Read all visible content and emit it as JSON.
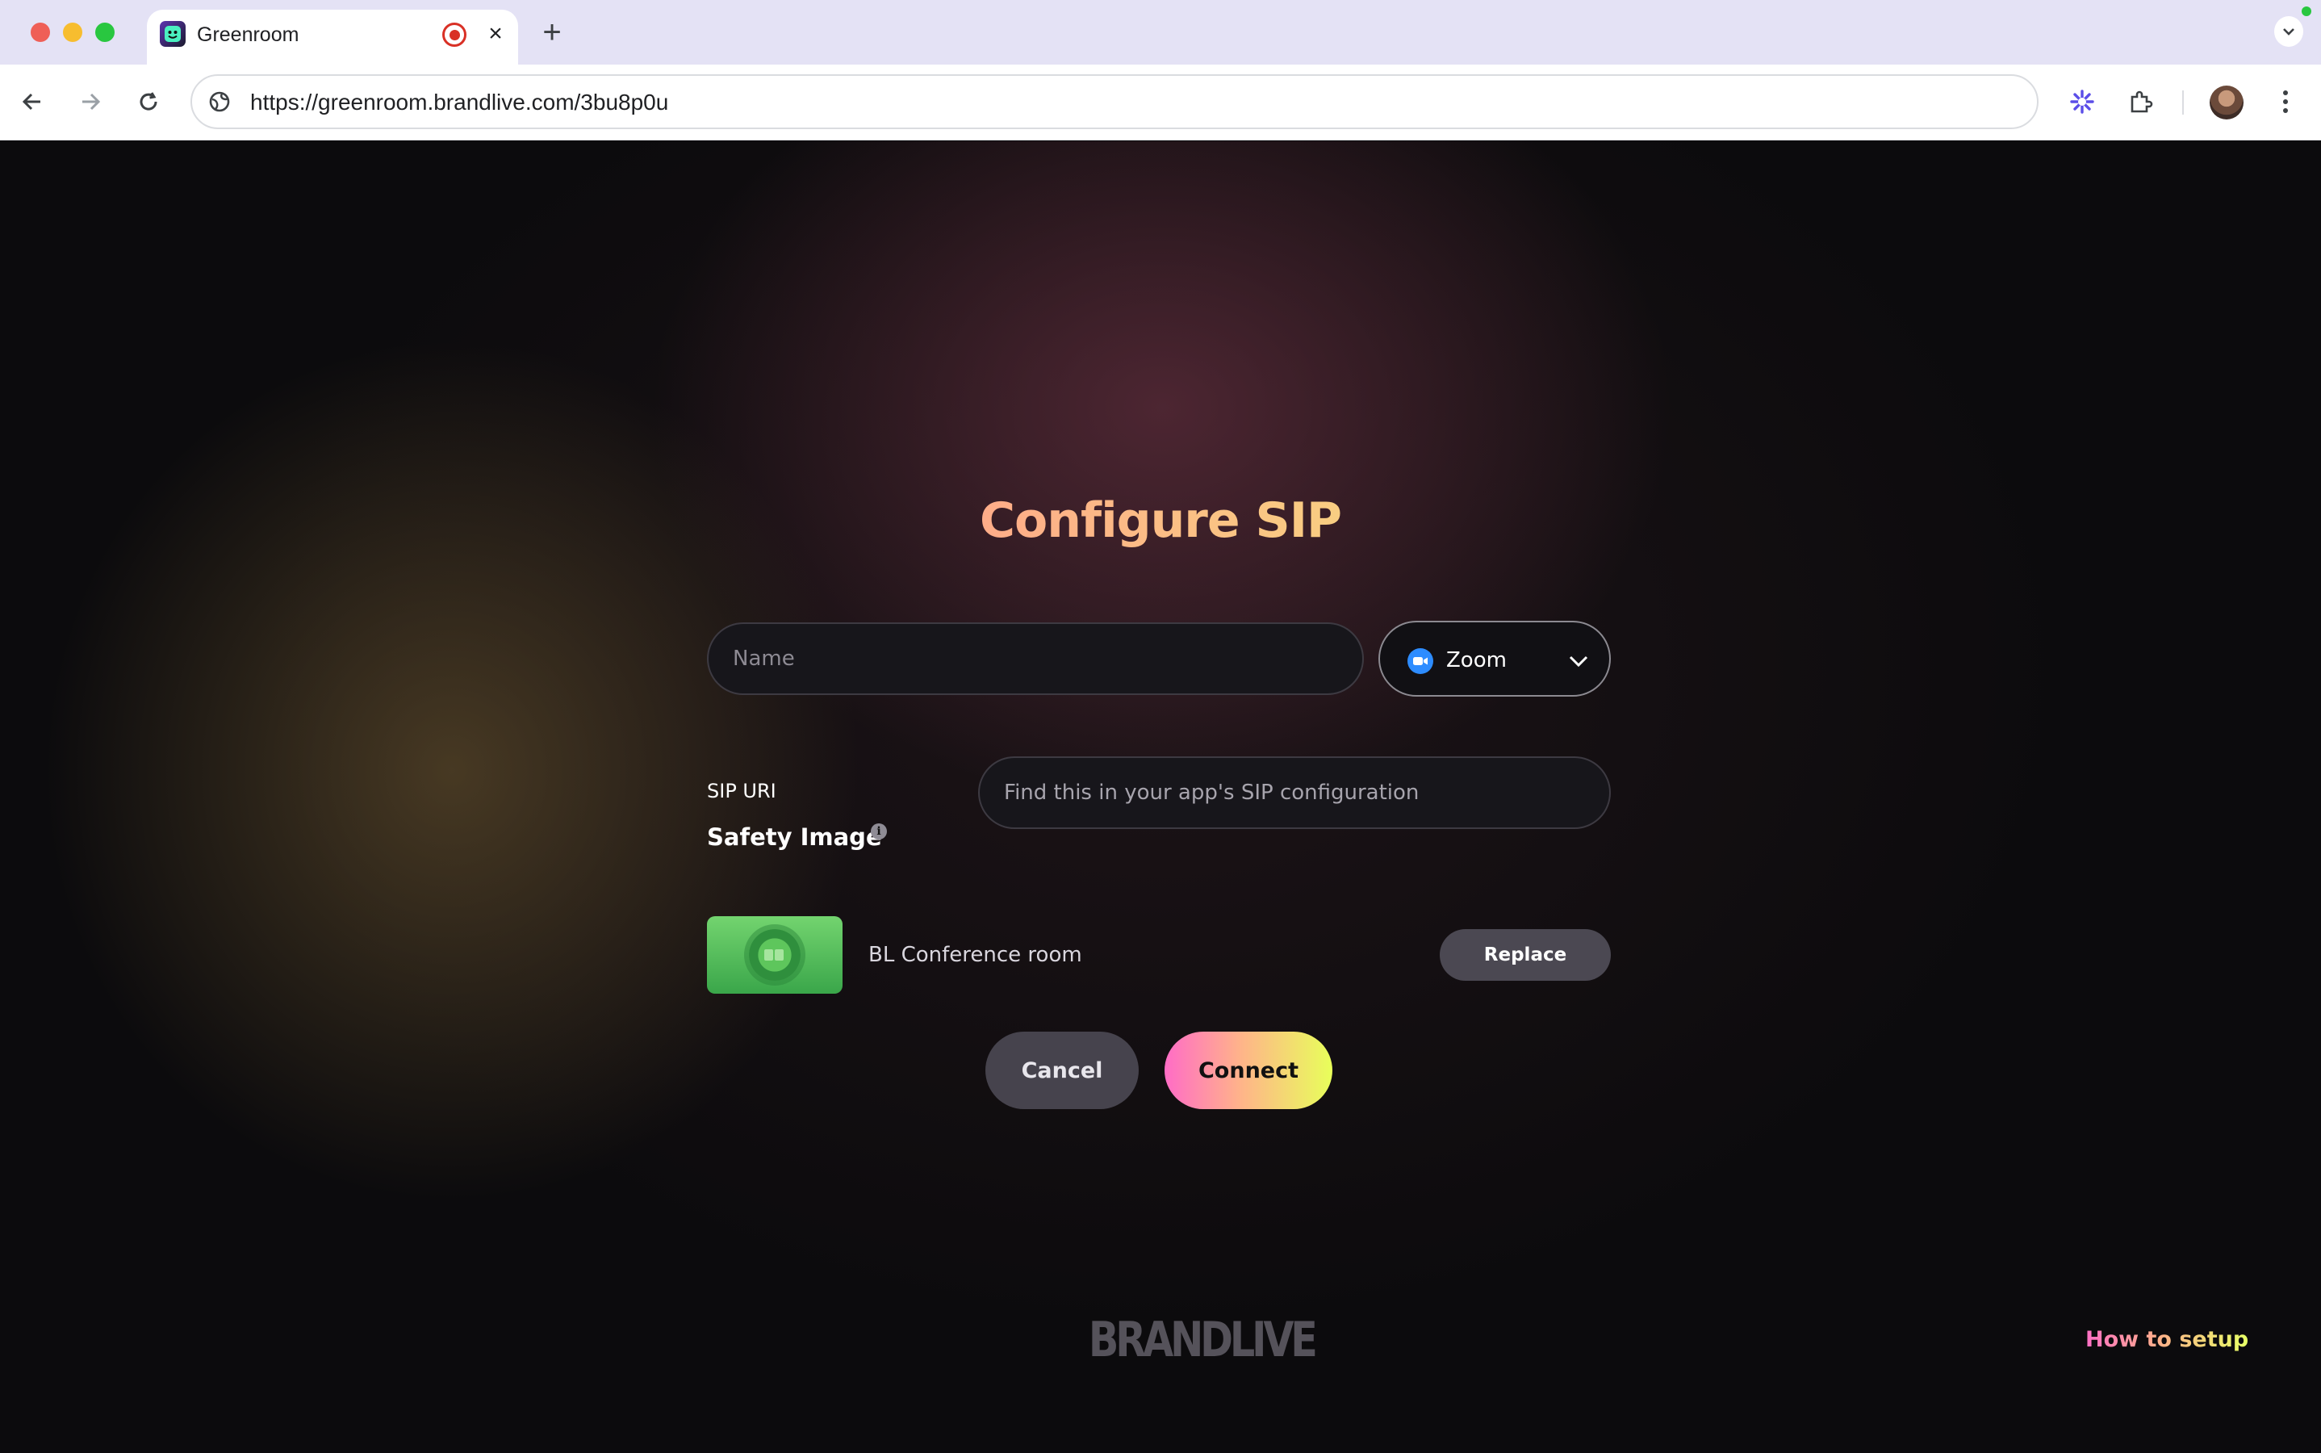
{
  "browser": {
    "tab_title": "Greenroom",
    "tab_close": "×",
    "new_tab": "+",
    "url": "https://greenroom.brandlive.com/3bu8p0u"
  },
  "form": {
    "title": "Configure SIP",
    "name_placeholder": "Name",
    "platform": {
      "selected": "Zoom",
      "icon": "zoom-icon"
    },
    "sip_label": "SIP URI",
    "sip_placeholder": "Find this in your app's SIP configuration",
    "safety_title": "Safety Image",
    "safety_info": "i",
    "safety_image_name": "BL Conference room",
    "replace_label": "Replace",
    "cancel_label": "Cancel",
    "connect_label": "Connect"
  },
  "footer": {
    "logo": "BRANDLIVE",
    "help_link": "How to setup"
  },
  "colors": {
    "accent_pink": "#ff6fc5",
    "accent_yellow": "#e8ff5a",
    "page_bg": "#0c0b0d",
    "zoom_blue": "#2d8cff"
  }
}
